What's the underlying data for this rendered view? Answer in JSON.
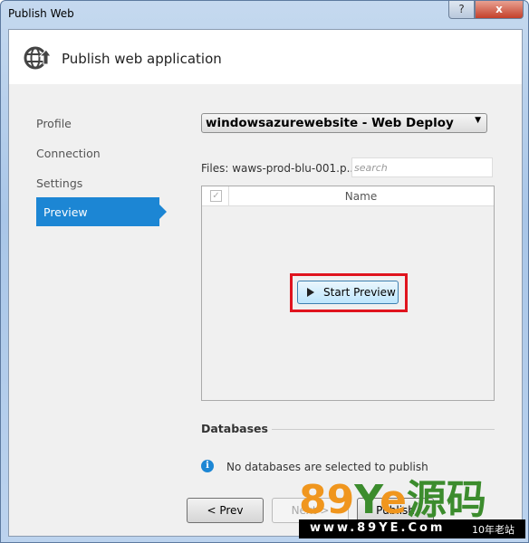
{
  "window": {
    "title": "Publish Web",
    "help_label": "?",
    "close_label": "x"
  },
  "header": {
    "title": "Publish web application",
    "icon": "globe-publish-icon"
  },
  "nav": {
    "items": [
      {
        "label": "Profile",
        "selected": false
      },
      {
        "label": "Connection",
        "selected": false
      },
      {
        "label": "Settings",
        "selected": false
      },
      {
        "label": "Preview",
        "selected": true
      }
    ]
  },
  "profile_select": {
    "value": "windowsazurewebsite - Web Deploy"
  },
  "files": {
    "label": "Files:",
    "value": "waws-prod-blu-001.p...",
    "search_placeholder": "search"
  },
  "grid": {
    "column_name": "Name",
    "start_preview_label": "Start Preview"
  },
  "databases": {
    "label": "Databases",
    "info": "No databases are selected to publish"
  },
  "footer": {
    "prev_label": "< Prev",
    "next_label": "Next >",
    "publish_label": "Publish"
  },
  "watermark": {
    "text": "89Ye源码",
    "url": "www.89YE.Com",
    "tag": "10年老站"
  },
  "colors": {
    "accent": "#1c86d4",
    "highlight": "#e0141e"
  }
}
